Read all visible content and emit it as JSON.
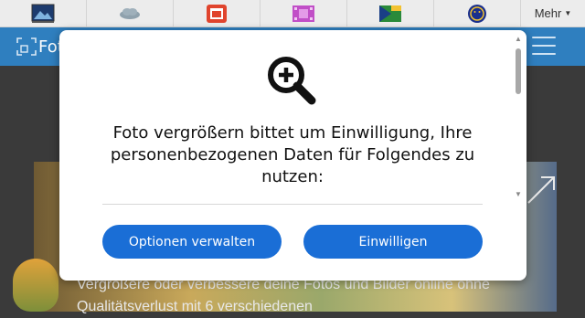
{
  "topbar": {
    "items": [
      {
        "icon": "landscape-photo-icon"
      },
      {
        "icon": "cloud-eye-icon"
      },
      {
        "icon": "photo-frame-icon"
      },
      {
        "icon": "film-strip-icon"
      },
      {
        "icon": "flag-photo-icon"
      },
      {
        "icon": "smiley-circle-icon"
      }
    ],
    "more_label": "Mehr"
  },
  "header": {
    "logo_text": "Fot",
    "logo_icon": "enlarge-frame-icon",
    "menu_icon": "hamburger-menu-icon"
  },
  "background": {
    "text": "Vergrößere oder verbessere deine Fotos und Bilder online ohne Qualitätsverlust mit 6 verschiedenen"
  },
  "modal": {
    "icon": "zoom-in-icon",
    "title": "Foto vergrößern bittet um Einwilligung, Ihre personenbezogenen Daten für Folgendes zu nutzen:",
    "manage_button": "Optionen verwalten",
    "consent_button": "Einwilligen"
  },
  "colors": {
    "header_blue": "#2f7fbf",
    "button_blue": "#1a6ed6"
  }
}
